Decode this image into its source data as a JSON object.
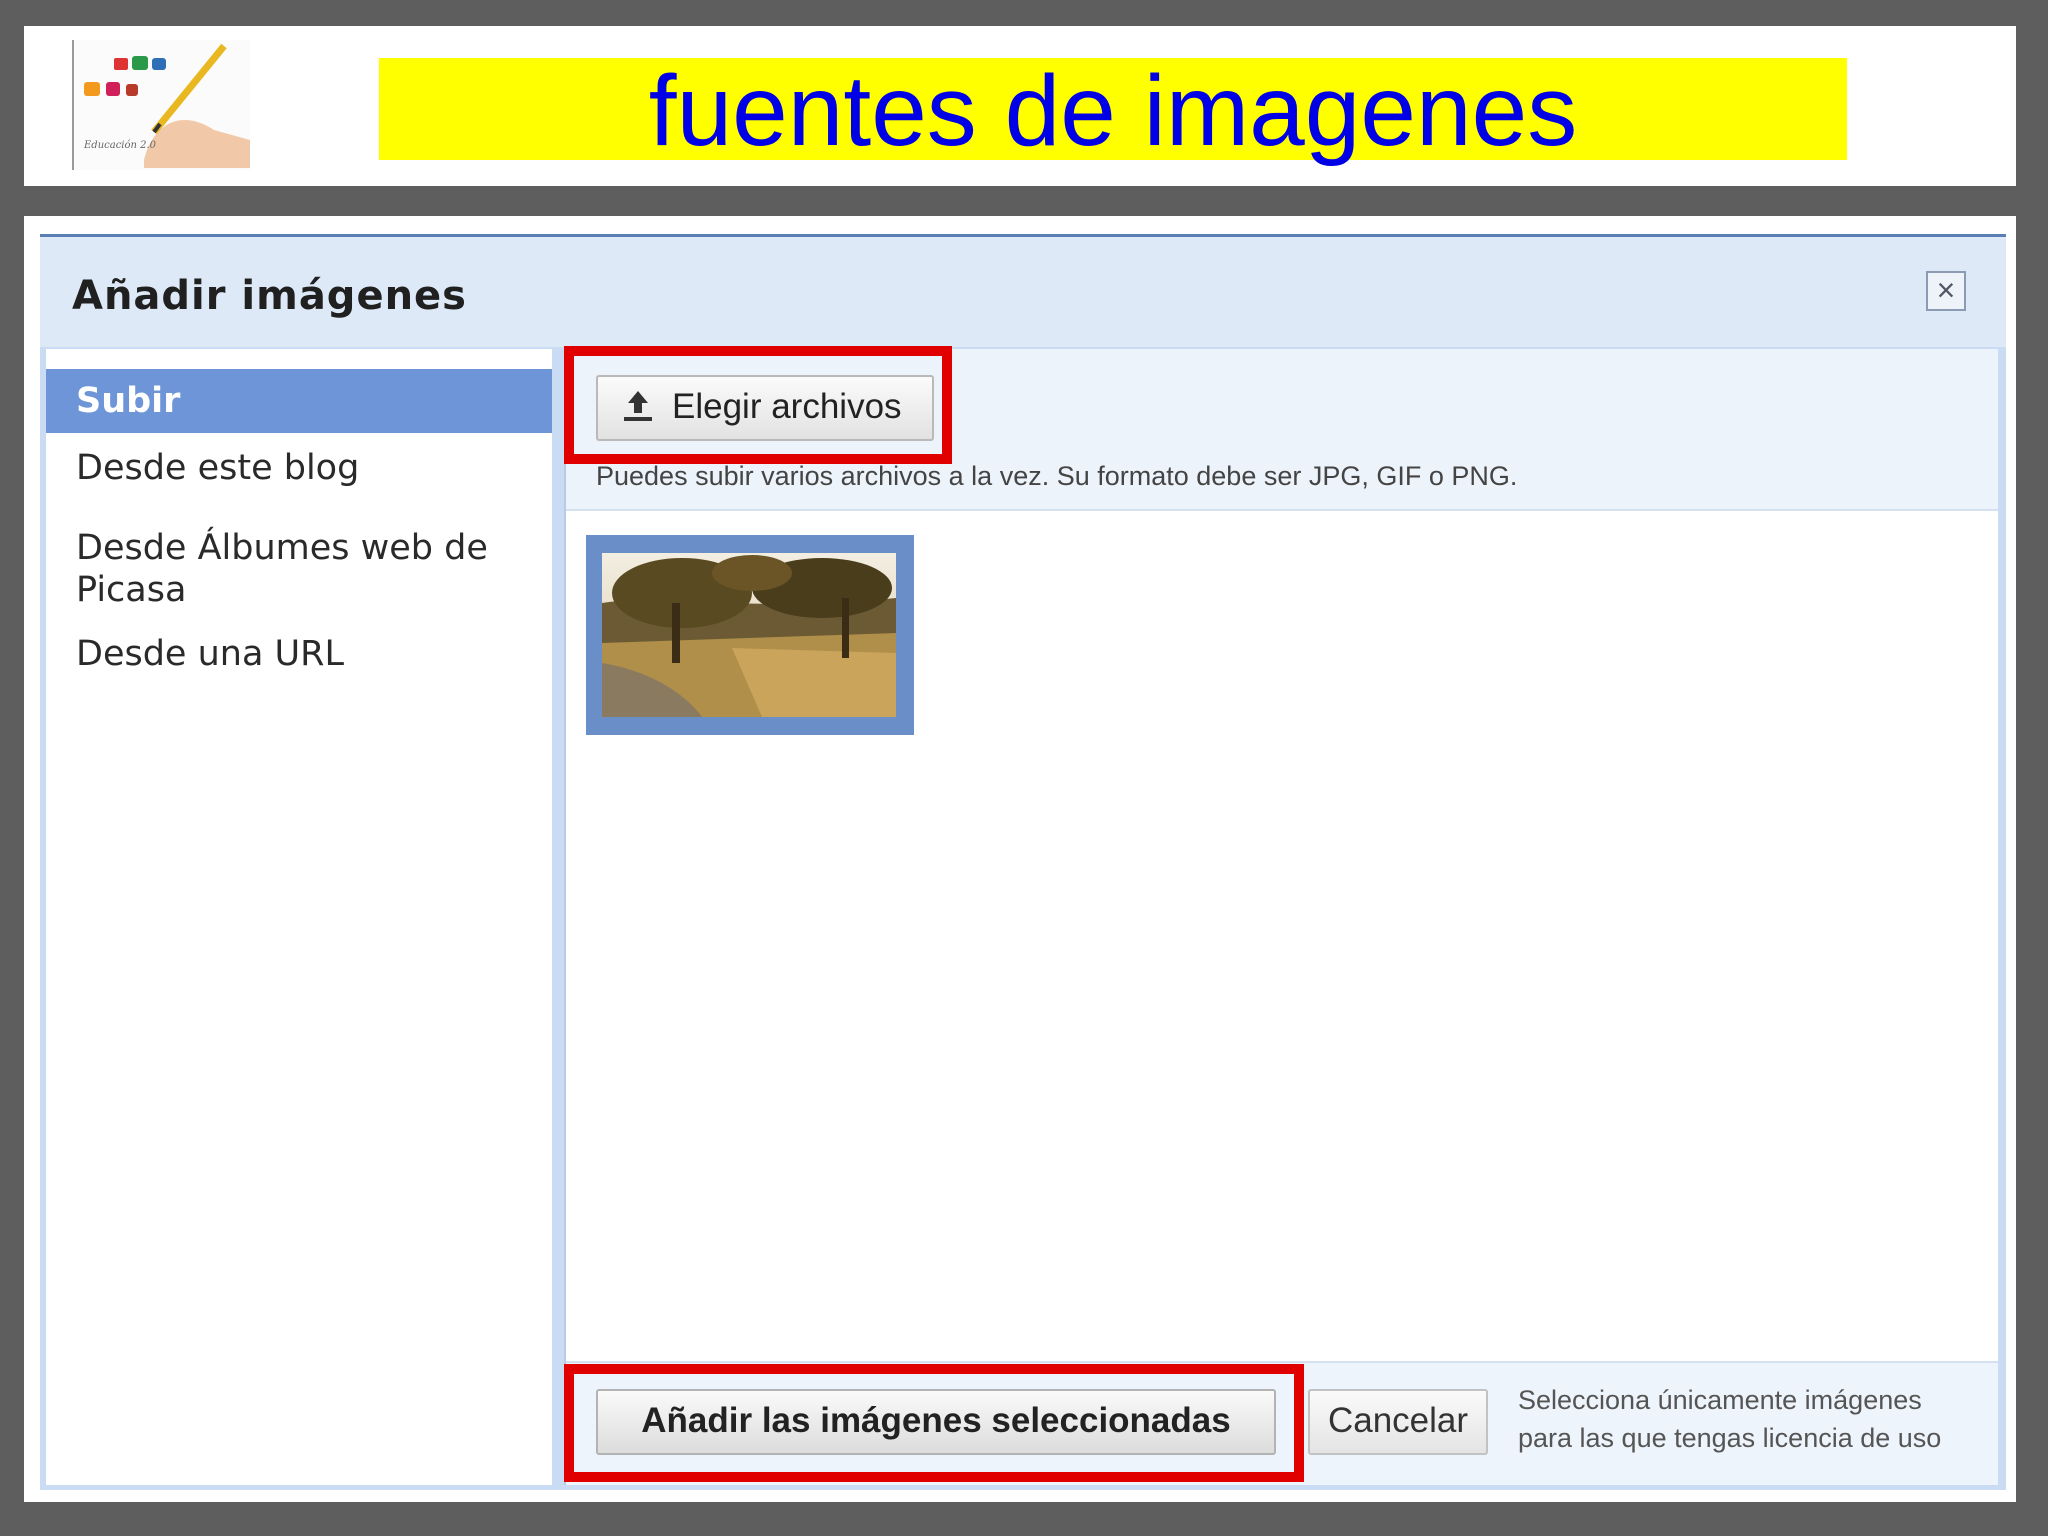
{
  "slide": {
    "title": "fuentes de imagenes",
    "logo_caption": "Educación 2.0",
    "title_background": "#ffff00",
    "title_color": "#0000e6",
    "highlight_color": "#e00000"
  },
  "dialog": {
    "title": "Añadir imágenes",
    "close_icon": "close-icon",
    "sidebar": {
      "items": [
        {
          "label": "Subir",
          "active": true
        },
        {
          "label": "Desde este blog",
          "active": false
        },
        {
          "label": "Desde Álbumes web de Picasa",
          "active": false
        },
        {
          "label": "Desde una URL",
          "active": false
        }
      ]
    },
    "upload": {
      "choose_label": "Elegir archivos",
      "hint": "Puedes subir varios archivos a la vez. Su formato debe ser JPG, GIF o PNG."
    },
    "footer": {
      "add_label": "Añadir las imágenes seleccionadas",
      "cancel_label": "Cancelar",
      "license_note": "Selecciona únicamente imágenes para las que tengas licencia de uso"
    }
  }
}
